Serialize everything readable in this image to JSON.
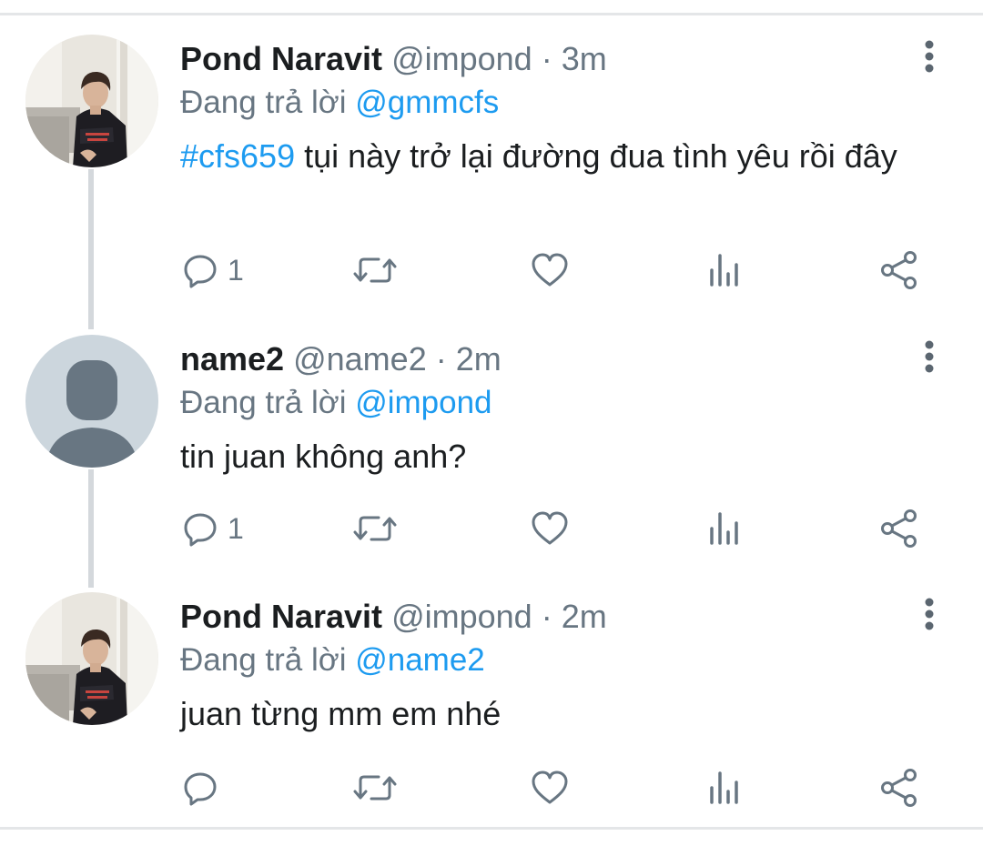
{
  "colors": {
    "link": "#1d9bf0",
    "secondary_text": "#687682",
    "primary_text": "#1b1e20",
    "thread_line": "#d4d8dc",
    "default_avatar_bg": "#ccd6dd",
    "default_avatar_fg": "#687682"
  },
  "tweets": [
    {
      "name": "Pond Naravit",
      "handle": "@impond",
      "separator": "·",
      "time": "3m",
      "replying_prefix": "Đang trả lời",
      "replying_to": "@gmmcfs",
      "hashtag": "#cfs659",
      "text": " tụi này trở lại đường đua tình yêu rồi đây",
      "avatar": "photo-avatar",
      "reply_count": "1"
    },
    {
      "name": "name2",
      "handle": "@name2",
      "separator": "·",
      "time": "2m",
      "replying_prefix": "Đang trả lời",
      "replying_to": "@impond",
      "hashtag": "",
      "text": "tin juan không anh?",
      "avatar": "default-avatar",
      "reply_count": "1"
    },
    {
      "name": "Pond Naravit",
      "handle": "@impond",
      "separator": "·",
      "time": "2m",
      "replying_prefix": "Đang trả lời",
      "replying_to": "@name2",
      "hashtag": "",
      "text": "juan từng mm em nhé",
      "avatar": "photo-avatar",
      "reply_count": ""
    }
  ],
  "icons": {
    "reply": "reply-icon",
    "retweet": "retweet-icon",
    "like": "heart-icon",
    "analytics": "analytics-icon",
    "share": "share-icon",
    "more": "more-vertical-icon"
  }
}
